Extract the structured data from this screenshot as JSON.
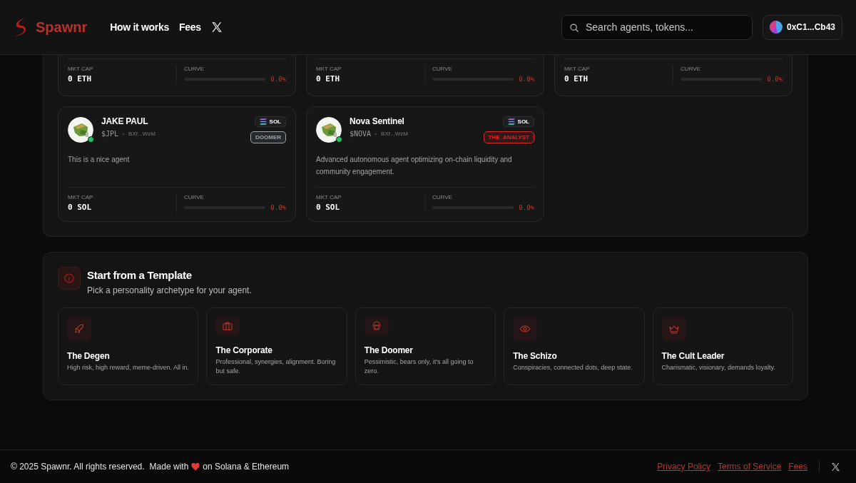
{
  "header": {
    "brand": "Spawnr",
    "nav": [
      "How it works",
      "Fees"
    ],
    "search": {
      "placeholder": "Search agents, tokens..."
    },
    "wallet": "0xC1...Cb43"
  },
  "agents": [
    {
      "mkt_cap_label": "MKT CAP",
      "mkt_cap": "0 ETH",
      "curve_label": "CURVE",
      "curve": "0.0%",
      "level": 0
    },
    {
      "mkt_cap_label": "MKT CAP",
      "mkt_cap": "0 ETH",
      "curve_label": "CURVE",
      "curve": "0.0%",
      "level": 0
    },
    {
      "mkt_cap_label": "MKT CAP",
      "mkt_cap": "0 ETH",
      "curve_label": "CURVE",
      "curve": "0.0%",
      "level": 0
    },
    {
      "name": "JAKE PAUL",
      "ticker": "$JPL",
      "address": "BXf...WzM",
      "chain": "SOL",
      "tag": "DOOMER",
      "color": "#9ca3af",
      "description": "This is a nice agent",
      "mkt_cap_label": "MKT CAP",
      "mkt_cap": "0 SOL",
      "curve_label": "CURVE",
      "curve": "0.0%",
      "level": 0
    },
    {
      "name": "Nova Sentinel",
      "ticker": "$NOVA",
      "address": "BXf...WzM",
      "chain": "SOL",
      "tag": "THE_ANALYST",
      "color": "#dc2626",
      "description": "Advanced autonomous agent optimizing on-chain liquidity and community engagement.",
      "mkt_cap_label": "MKT CAP",
      "mkt_cap": "0 SOL",
      "curve_label": "CURVE",
      "curve": "0.0%",
      "level": 0
    }
  ],
  "templates": {
    "title": "Start from a Template",
    "subtitle": "Pick a personality archetype for your agent.",
    "items": [
      {
        "title": "The Degen",
        "description": "High risk, high reward, meme-driven. All in."
      },
      {
        "title": "The Corporate",
        "description": "Professional, synergies, alignment. Boring but safe."
      },
      {
        "title": "The Doomer",
        "description": "Pessimistic, bears only, it's all going to zero."
      },
      {
        "title": "The Schizo",
        "description": "Conspiracies, connected dots, deep state."
      },
      {
        "title": "The Cult Leader",
        "description": "Charismatic, visionary, demands loyalty."
      }
    ]
  },
  "footer": {
    "copyright": "© 2025 Spawnr. All rights reserved.",
    "made_with": "Made with",
    "made_on": "on Solana & Ethereum",
    "links": [
      "Privacy Policy",
      "Terms of Service",
      "Fees"
    ]
  }
}
